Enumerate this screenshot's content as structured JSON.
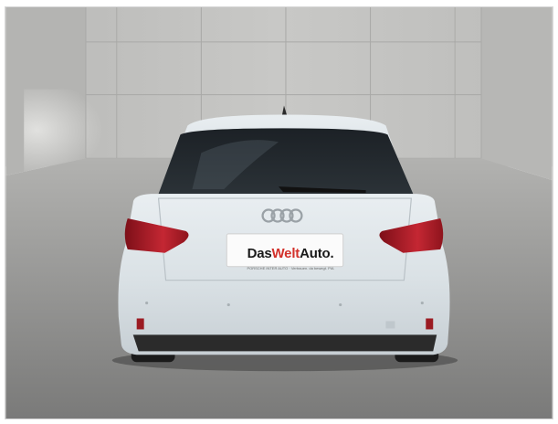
{
  "photo": {
    "subject": "car-rear-view",
    "badge_icon": "four-rings-logo-icon",
    "dealer_plate": {
      "brand_part1": "Das",
      "brand_part2": "Welt",
      "brand_part3": "Auto.",
      "subline": "PORSCHE INTER AUTO · Vertrauen. da bewegt. PIA"
    },
    "colors": {
      "car_body": "#d8dfe3",
      "taillight": "#b3202a",
      "wall": "#c9c9c7",
      "floor": "#8f8f8d",
      "plate_accent": "#d3312b"
    }
  }
}
